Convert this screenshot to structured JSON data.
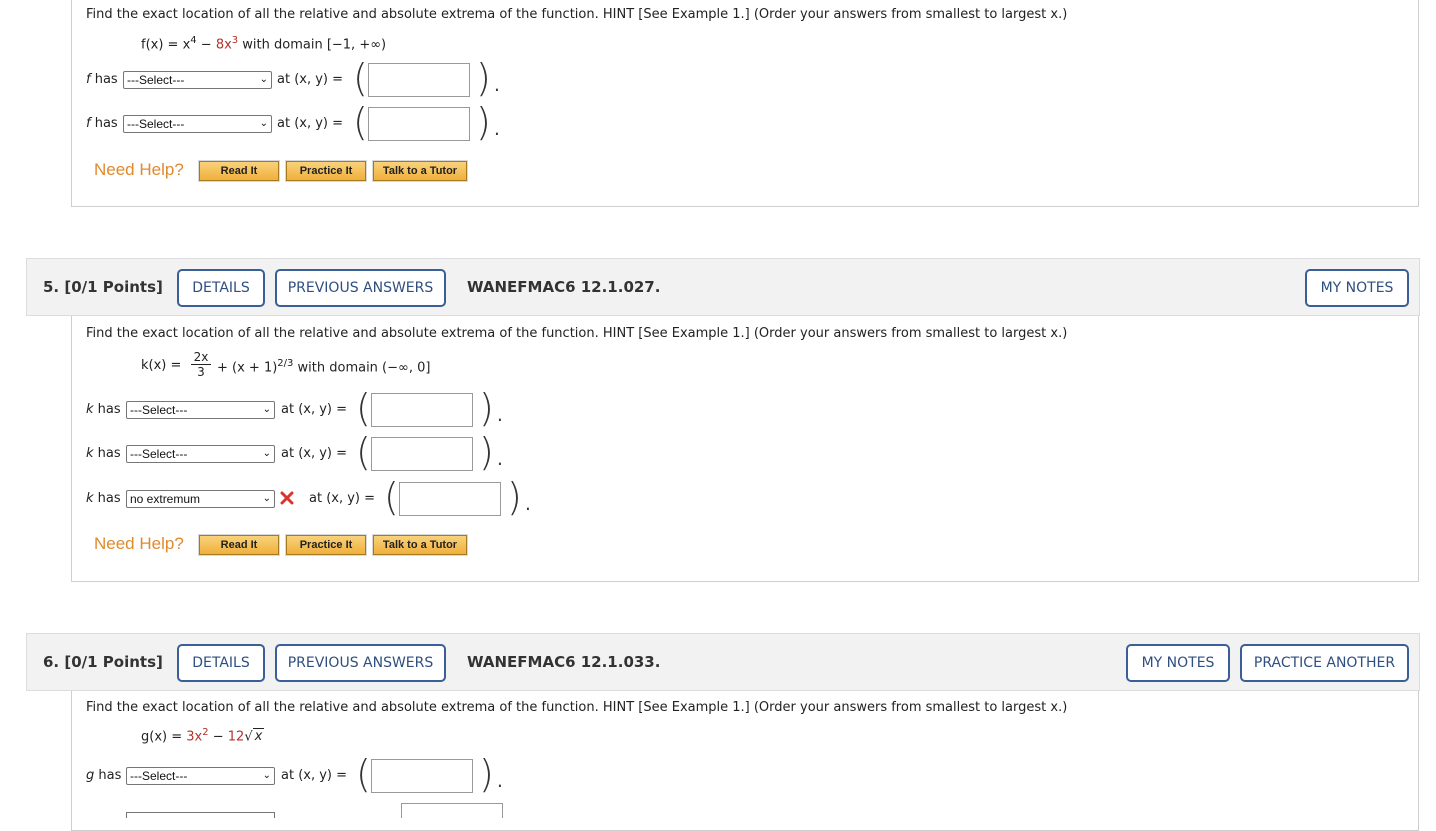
{
  "q4": {
    "prompt": "Find the exact location of all the relative and absolute extrema of the function. HINT [See Example 1.] (Order your answers from smallest to largest x.)",
    "formula": {
      "lhs": "f(x) = x",
      "exp1": "4",
      "minus": " − ",
      "term2": "8x",
      "exp2": "3",
      "domain": " with domain [−1, +∞)"
    },
    "rows": [
      {
        "label": "f has",
        "select": "---Select---",
        "at": "at  (x, y) ="
      },
      {
        "label": "f has",
        "select": "---Select---",
        "at": "at  (x, y) ="
      }
    ]
  },
  "q5": {
    "number": "5.  [0/1 Points]",
    "details": "DETAILS",
    "previous_answers": "PREVIOUS ANSWERS",
    "code": "WANEFMAC6 12.1.027.",
    "my_notes": "MY NOTES",
    "prompt": "Find the exact location of all the relative and absolute extrema of the function. HINT [See Example 1.] (Order your answers from smallest to largest x.)",
    "formula": {
      "lhs": "k(x) =",
      "num": "2x",
      "den": "3",
      "mid": "+ (x + 1)",
      "exp": "2/3",
      "domain": " with domain (−∞, 0]"
    },
    "rows": [
      {
        "label": "k has",
        "select": "---Select---",
        "at": "at  (x, y) ="
      },
      {
        "label": "k has",
        "select": "---Select---",
        "at": "at  (x, y) ="
      },
      {
        "label": "k has",
        "select": "no extremum",
        "at": "at  (x, y) ="
      }
    ]
  },
  "q6": {
    "number": "6.  [0/1 Points]",
    "details": "DETAILS",
    "previous_answers": "PREVIOUS ANSWERS",
    "code": "WANEFMAC6 12.1.033.",
    "my_notes": "MY NOTES",
    "practice_another": "PRACTICE ANOTHER",
    "prompt": "Find the exact location of all the relative and absolute extrema of the function. HINT [See Example 1.] (Order your answers from smallest to largest x.)",
    "formula": {
      "lhs": "g(x) = ",
      "term1": "3x",
      "exp1": "2",
      "minus": " − ",
      "term2": "12",
      "radicand": "x"
    },
    "rows": [
      {
        "label": "g has",
        "select": "---Select---",
        "at": "at  (x, y) ="
      }
    ]
  },
  "help": {
    "label": "Need Help?",
    "read_it": "Read It",
    "practice_it": "Practice It",
    "talk_tutor": "Talk to a Tutor"
  },
  "colors": {
    "accent": "#3a5f96",
    "help_orange": "#e08a2e",
    "error_red": "#d9352c"
  }
}
